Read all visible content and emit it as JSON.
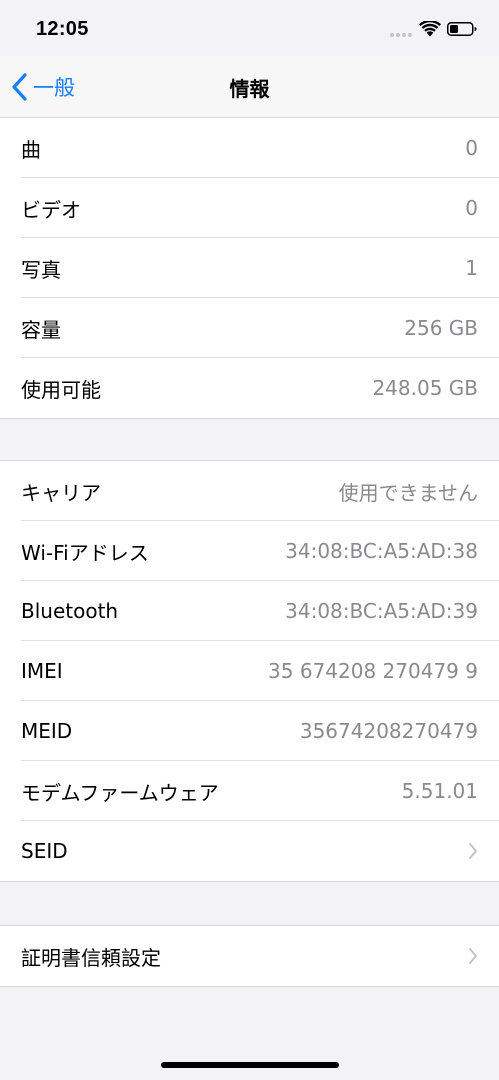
{
  "status_bar": {
    "time": "12:05"
  },
  "nav": {
    "back_label": "一般",
    "title": "情報"
  },
  "groups": [
    {
      "rows": [
        {
          "label": "曲",
          "value": "0"
        },
        {
          "label": "ビデオ",
          "value": "0"
        },
        {
          "label": "写真",
          "value": "1"
        },
        {
          "label": "容量",
          "value": "256 GB"
        },
        {
          "label": "使用可能",
          "value": "248.05 GB"
        }
      ]
    },
    {
      "rows": [
        {
          "label": "キャリア",
          "value": "使用できません"
        },
        {
          "label": "Wi-Fiアドレス",
          "value": "34:08:BC:A5:AD:38"
        },
        {
          "label": "Bluetooth",
          "value": "34:08:BC:A5:AD:39"
        },
        {
          "label": "IMEI",
          "value": "35 674208 270479 9"
        },
        {
          "label": "MEID",
          "value": "35674208270479"
        },
        {
          "label": "モデムファームウェア",
          "value": "5.51.01"
        },
        {
          "label": "SEID",
          "value": ""
        }
      ]
    },
    {
      "rows": [
        {
          "label": "証明書信頼設定",
          "value": ""
        }
      ]
    }
  ],
  "colors": {
    "accent": "#157efb",
    "background": "#f2f2f7",
    "secondary_text": "#8a8a8e"
  },
  "icons": {
    "back": "chevron-left-icon",
    "disclosure": "chevron-right-icon",
    "wifi": "wifi-icon",
    "battery": "battery-icon",
    "signal": "signal-dots-icon"
  }
}
